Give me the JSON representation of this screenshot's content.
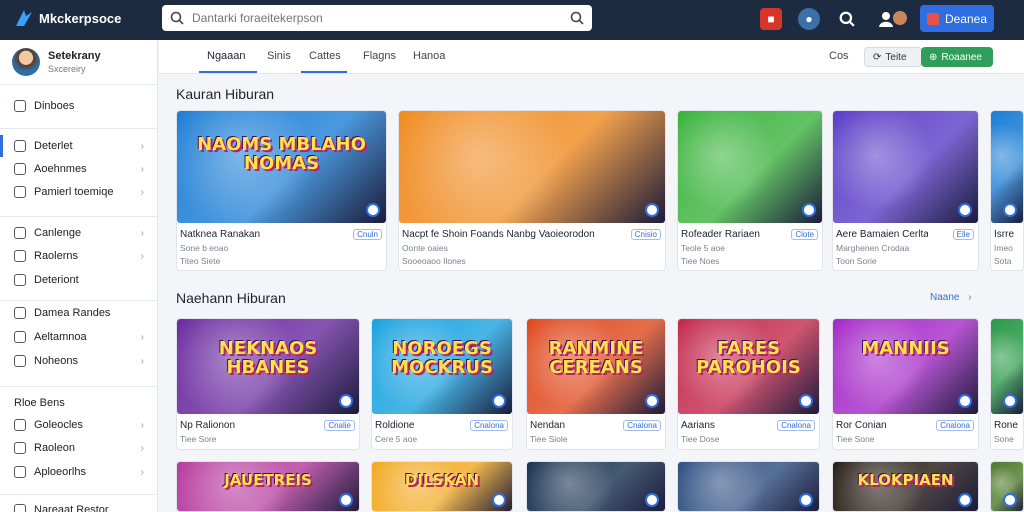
{
  "app": {
    "name": "Mkckerpsoce"
  },
  "search": {
    "placeholder": "Dantarki foraeitekerpson"
  },
  "top": {
    "button_label": "Deanea"
  },
  "profile": {
    "name": "Setekrany",
    "subtitle": "Sxcereiry"
  },
  "sidebar": {
    "items": [
      {
        "label": "Dinboes",
        "chevron": false
      },
      {
        "label": "Deterlet",
        "chevron": true
      },
      {
        "label": "Aoehnmes",
        "chevron": true
      },
      {
        "label": "Pamierl toemiqe",
        "chevron": true
      },
      {
        "label": "Canlenge",
        "chevron": true
      },
      {
        "label": "Raolerns",
        "chevron": true
      },
      {
        "label": "Deteriont",
        "chevron": false
      },
      {
        "label": "Damea Randes",
        "chevron": false
      },
      {
        "label": "Aeltamnoa",
        "chevron": true
      },
      {
        "label": "Noheons",
        "chevron": true
      },
      {
        "label": "Rloe Bens",
        "chevron": false
      },
      {
        "label": "Goleocles",
        "chevron": true
      },
      {
        "label": "Raoleon",
        "chevron": true
      },
      {
        "label": "Aploeorlhs",
        "chevron": true
      },
      {
        "label": "Nareaat Restor",
        "chevron": false
      }
    ]
  },
  "tabs": [
    {
      "label": "Ngaaan"
    },
    {
      "label": "Sinis"
    },
    {
      "label": "Cattes"
    },
    {
      "label": "Flagns"
    },
    {
      "label": "Hanoa"
    }
  ],
  "toolbar": {
    "text": "Cos",
    "pill1": "Teite",
    "pill2": "Roaanee"
  },
  "section1": {
    "title": "Kauran Hiburan",
    "cards": [
      {
        "title": "Natknea Ranakan",
        "badge": "Cnuln",
        "sub1": "Sone b eoao",
        "sub2": "Titeo  Siete",
        "thumb_text": "NAOMS MBLAHO NOMAS",
        "bg": "#1e7fd6"
      },
      {
        "title": "Nacpt fe Shoin Foands Nanbg Vaoieorodon",
        "badge": "Cnisio",
        "sub1": "Oonte oaies",
        "sub2": "Sooeoaoo Ilones",
        "thumb_text": "",
        "bg": "#f08a1f"
      },
      {
        "title": "Rofeader Rariaen",
        "badge": "Clote",
        "sub1": "Teole 5 aoe",
        "sub2": "Tiee  Noes",
        "thumb_text": "",
        "bg": "#3cb43e"
      },
      {
        "title": "Aere Bamaien Cerltan",
        "badge": "Elle",
        "sub1": "Marghenen Crodaa",
        "sub2": "Toon  Sorie",
        "thumb_text": "",
        "bg": "#5b3fc8"
      },
      {
        "title": "Isrre",
        "badge": "",
        "sub1": "Imeo",
        "sub2": "Sota",
        "thumb_text": "",
        "bg": "#1e7fd6"
      }
    ]
  },
  "section2": {
    "title": "Naehann Hiburan",
    "more": "Naane",
    "cards": [
      {
        "title": "Np Ralionon",
        "badge": "Cnalie",
        "sub1": "Tiee  Sore",
        "thumb_text": "NEKNAOS HBANES",
        "bg": "#6a2aa0"
      },
      {
        "title": "Roldione",
        "badge": "Cnalona",
        "sub1": "Cere 5 aoe",
        "thumb_text": "NOROEGS MOCKRUS",
        "bg": "#1aa3e0"
      },
      {
        "title": "Nendan",
        "badge": "Cnalona",
        "sub1": "Tiee  Siole",
        "thumb_text": "RANMINE CEREANS",
        "bg": "#e04a1f"
      },
      {
        "title": "Aarians",
        "badge": "Cnalona",
        "sub1": "Tiee  Dose",
        "thumb_text": "FARES PAROHOIS",
        "bg": "#c42a4e"
      },
      {
        "title": "Ror Conian",
        "badge": "Cnalona",
        "sub1": "Tiee  Sone",
        "thumb_text": "MANNIIS",
        "bg": "#a62ac8"
      },
      {
        "title": "Rone",
        "badge": "",
        "sub1": "Sone",
        "thumb_text": "",
        "bg": "#2a9a48"
      }
    ]
  },
  "section3": {
    "thumbs": [
      {
        "thumb_text": "JAUETREIS",
        "bg": "#b5389c"
      },
      {
        "thumb_text": "DILSKAN",
        "bg": "#f2a81e"
      },
      {
        "thumb_text": "",
        "bg": "#16304f"
      },
      {
        "thumb_text": "",
        "bg": "#2c4d80"
      },
      {
        "thumb_text": "KLOKPIAEN",
        "bg": "#251a12"
      },
      {
        "thumb_text": "",
        "bg": "#4f7a2c"
      }
    ]
  },
  "colors": {
    "accent": "#2f6ee0",
    "topbar": "#1d2b40",
    "green": "#2f9e5a"
  }
}
